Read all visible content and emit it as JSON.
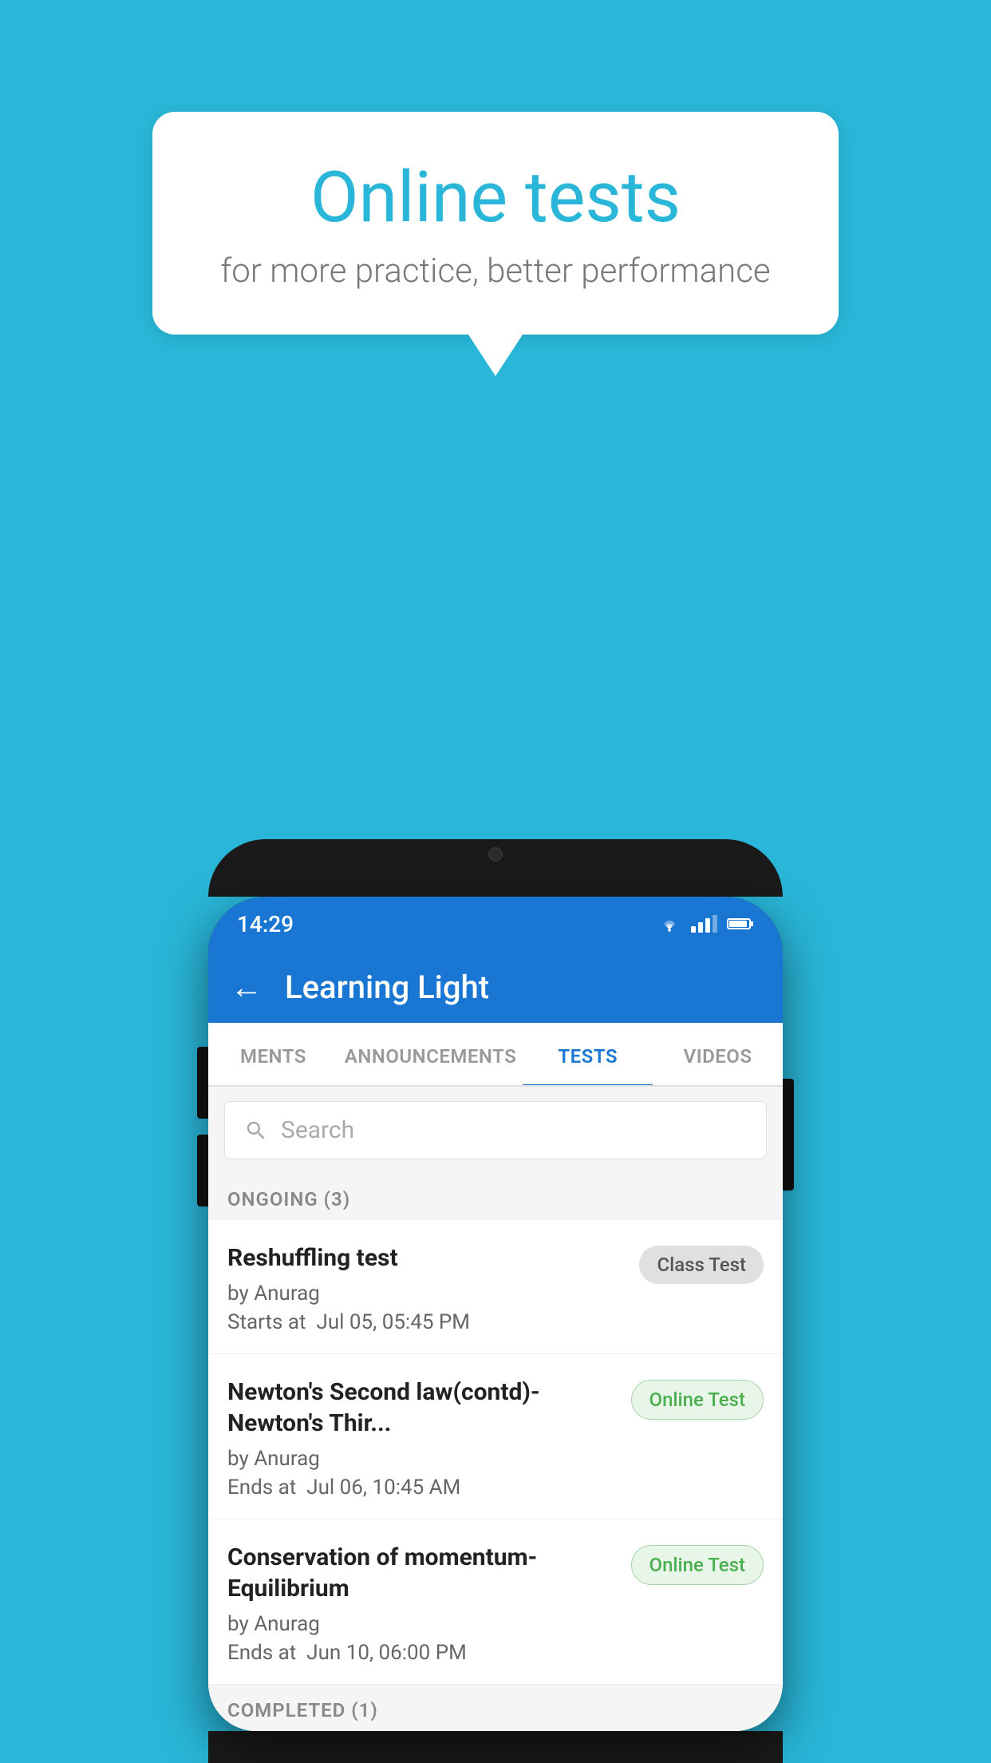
{
  "background_color": "#29b6d8",
  "speech_bubble": {
    "title": "Online tests",
    "subtitle": "for more practice, better performance"
  },
  "phone": {
    "status_bar": {
      "time": "14:29"
    },
    "app_bar": {
      "title": "Learning Light",
      "back_label": "←"
    },
    "tabs": [
      {
        "label": "MENTS",
        "active": false
      },
      {
        "label": "ANNOUNCEMENTS",
        "active": false
      },
      {
        "label": "TESTS",
        "active": true
      },
      {
        "label": "VIDEOS",
        "active": false
      }
    ],
    "search": {
      "placeholder": "Search"
    },
    "ongoing_section": {
      "label": "ONGOING (3)"
    },
    "tests": [
      {
        "name": "Reshuffling test",
        "by": "by Anurag",
        "date_label": "Starts at",
        "date": "Jul 05, 05:45 PM",
        "badge": "Class Test",
        "badge_type": "class"
      },
      {
        "name": "Newton's Second law(contd)-Newton's Thir...",
        "by": "by Anurag",
        "date_label": "Ends at",
        "date": "Jul 06, 10:45 AM",
        "badge": "Online Test",
        "badge_type": "online"
      },
      {
        "name": "Conservation of momentum-Equilibrium",
        "by": "by Anurag",
        "date_label": "Ends at",
        "date": "Jun 10, 06:00 PM",
        "badge": "Online Test",
        "badge_type": "online"
      }
    ],
    "completed_section": {
      "label": "COMPLETED (1)"
    }
  }
}
